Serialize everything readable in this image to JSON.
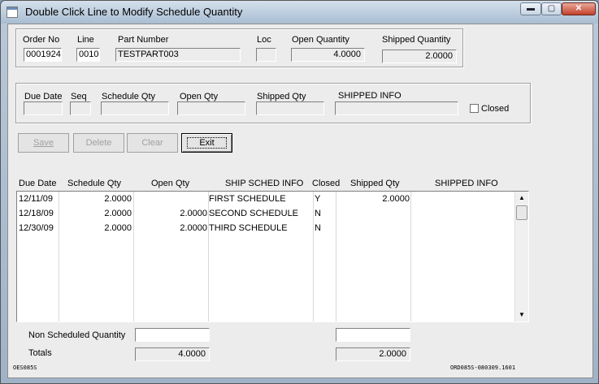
{
  "window": {
    "title": "Double Click Line to Modify Schedule Quantity",
    "min": "▬",
    "max": "▢",
    "close": "✕"
  },
  "header": {
    "order_no_label": "Order No",
    "order_no": "0001924",
    "line_label": "Line",
    "line": "0010",
    "part_label": "Part Number",
    "part": "TESTPART003",
    "loc_label": "Loc",
    "loc": "",
    "open_qty_label": "Open Quantity",
    "open_qty": "4.0000",
    "shipped_qty_label": "Shipped Quantity",
    "shipped_qty": "2.0000"
  },
  "entry": {
    "due_date_label": "Due Date",
    "seq_label": "Seq",
    "sched_qty_label": "Schedule Qty",
    "open_qty_label": "Open Qty",
    "shipped_qty_label": "Shipped Qty",
    "shipped_info_label": "SHIPPED INFO",
    "closed_label": "Closed"
  },
  "buttons": {
    "save": "Save",
    "delete": "Delete",
    "clear": "Clear",
    "exit": "Exit"
  },
  "grid": {
    "columns": [
      "Due Date",
      "Schedule Qty",
      "Open Qty",
      "SHIP SCHED INFO",
      "Closed",
      "Shipped Qty",
      "SHIPPED INFO"
    ],
    "rows": [
      {
        "due": "12/11/09",
        "sched": "2.0000",
        "open": "",
        "info": "FIRST SCHEDULE",
        "closed": "Y",
        "shipped": "2.0000",
        "sinfo": ""
      },
      {
        "due": "12/18/09",
        "sched": "2.0000",
        "open": "2.0000",
        "info": "SECOND SCHEDULE",
        "closed": "N",
        "shipped": "",
        "sinfo": ""
      },
      {
        "due": "12/30/09",
        "sched": "2.0000",
        "open": "2.0000",
        "info": "THIRD SCHEDULE",
        "closed": "N",
        "shipped": "",
        "sinfo": ""
      }
    ]
  },
  "footer": {
    "non_sched_label": "Non Scheduled Quantity",
    "non_sched_open": "",
    "non_sched_shipped": "",
    "totals_label": "Totals",
    "total_open": "4.0000",
    "total_shipped": "2.0000",
    "form_id": "OES085S",
    "version_id": "ORD085S-080309.1601"
  }
}
